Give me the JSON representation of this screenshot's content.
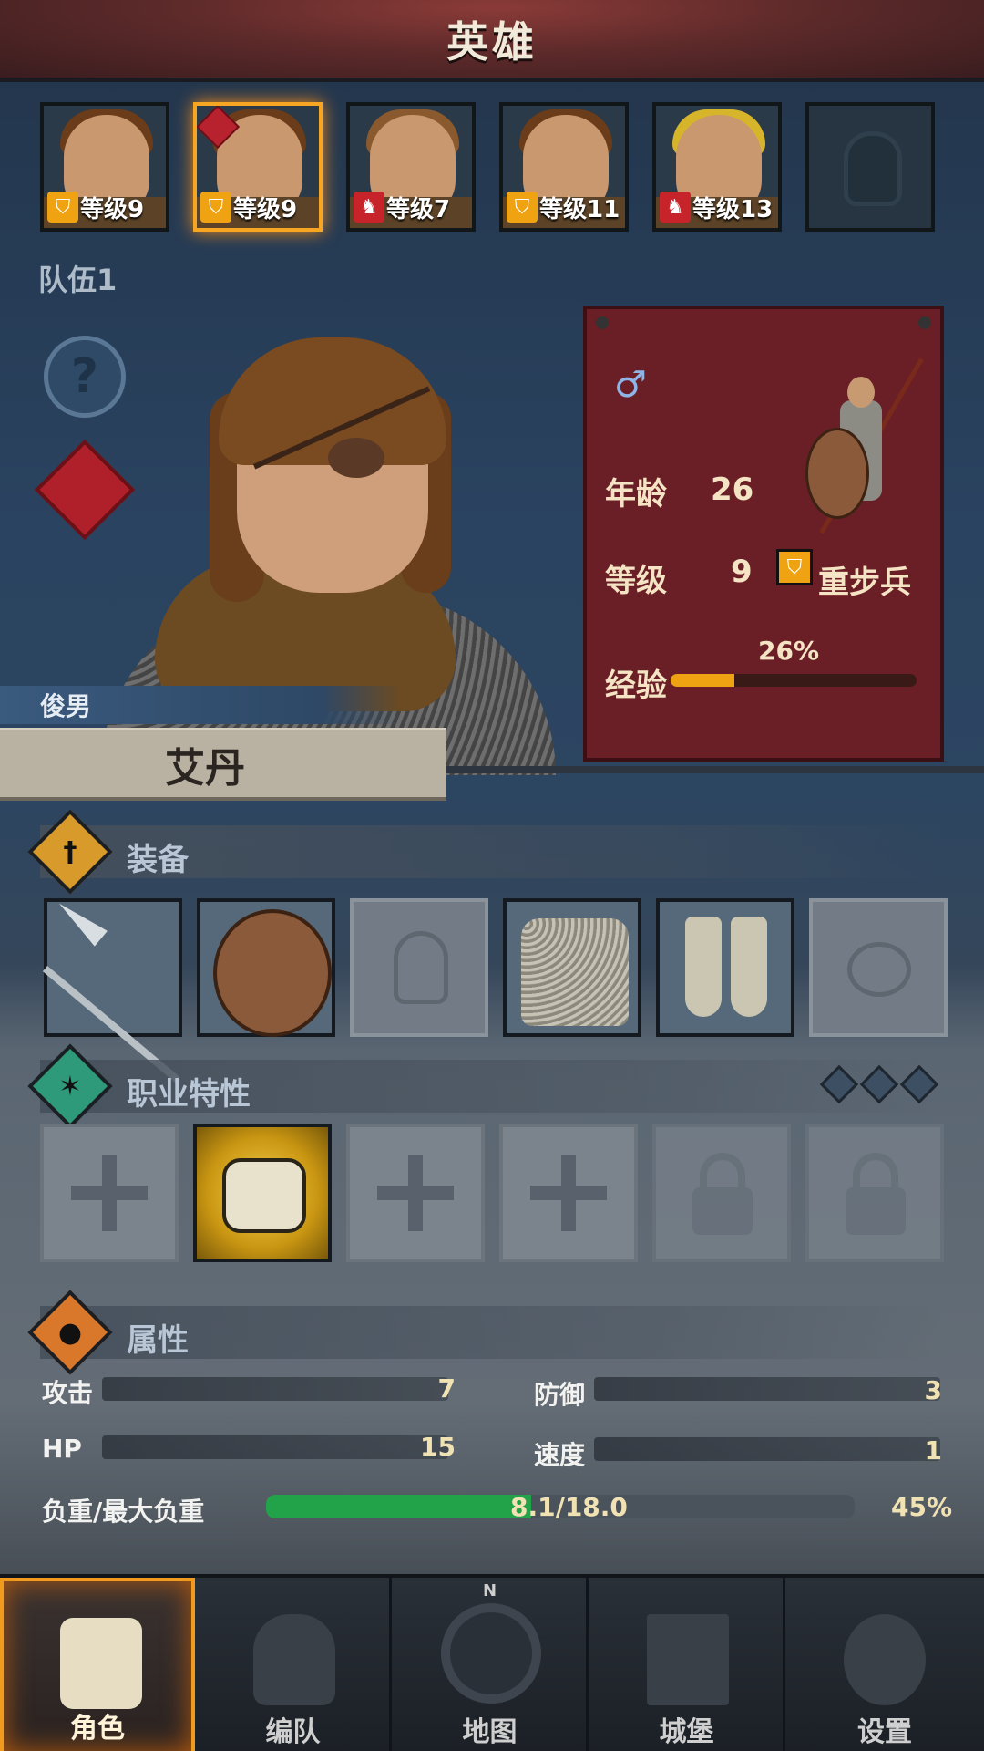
{
  "header": {
    "title": "英雄"
  },
  "roster": {
    "slots": [
      {
        "level_label": "等级9",
        "class_icon": "shield-icon",
        "selected": false,
        "hair": "brown"
      },
      {
        "level_label": "等级9",
        "class_icon": "shield-icon",
        "selected": true,
        "hair": "brown"
      },
      {
        "level_label": "等级7",
        "class_icon": "horse-icon",
        "selected": false,
        "hair": "light-brown"
      },
      {
        "level_label": "等级11",
        "class_icon": "shield-icon",
        "selected": false,
        "hair": "brown"
      },
      {
        "level_label": "等级13",
        "class_icon": "horse-icon",
        "selected": false,
        "hair": "blond"
      },
      {
        "empty": true
      }
    ],
    "team_label": "队伍1"
  },
  "hero": {
    "type_label": "俊男",
    "name": "艾丹",
    "gender_symbol": "♂",
    "age_label": "年龄",
    "age": "26",
    "level_label": "等级",
    "level": "9",
    "class": "重步兵",
    "exp_label": "经验",
    "exp_percent_text": "26%",
    "exp_fraction": 0.26
  },
  "sections": {
    "equipment": {
      "title": "装备",
      "icon": "sword-icon"
    },
    "traits": {
      "title": "职业特性",
      "icon": "star-icon",
      "gems": 3
    },
    "attributes": {
      "title": "属性",
      "icon": "person-icon"
    }
  },
  "equipment_slots": [
    {
      "item": "spear-icon",
      "filled": true
    },
    {
      "item": "round-shield-icon",
      "filled": true
    },
    {
      "item": "helmet-icon",
      "filled": false
    },
    {
      "item": "chainmail-icon",
      "filled": true
    },
    {
      "item": "boots-icon",
      "filled": true
    },
    {
      "item": "ring-icon",
      "filled": false
    }
  ],
  "trait_slots": [
    {
      "state": "empty"
    },
    {
      "state": "active",
      "icon": "gauntlet-icon"
    },
    {
      "state": "empty"
    },
    {
      "state": "empty"
    },
    {
      "state": "locked"
    },
    {
      "state": "locked"
    }
  ],
  "attributes": {
    "attack_label": "攻击",
    "attack": "7",
    "defense_label": "防御",
    "defense": "3",
    "hp_label": "HP",
    "hp": "15",
    "speed_label": "速度",
    "speed": "1",
    "load_label": "负重/最大负重",
    "load_text": "8.1/18.0",
    "load_percent_text": "45%",
    "load_fraction": 0.45
  },
  "nav": {
    "tabs": [
      {
        "label": "角色",
        "icon": "knight-icon",
        "active": true
      },
      {
        "label": "编队",
        "icon": "helmet-icon",
        "active": false
      },
      {
        "label": "地图",
        "icon": "compass-icon",
        "active": false,
        "compass_n": "N"
      },
      {
        "label": "城堡",
        "icon": "castle-icon",
        "active": false
      },
      {
        "label": "设置",
        "icon": "gear-icon",
        "active": false
      }
    ]
  },
  "colors": {
    "accent": "#f0a312",
    "card": "#6a1f27",
    "load_fill": "#22a34a",
    "active_tab": "#f09a1e"
  }
}
